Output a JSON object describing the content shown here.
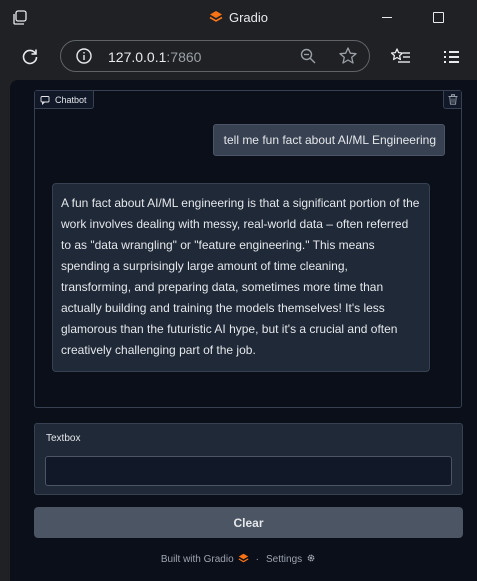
{
  "browser": {
    "tab_title": "Gradio",
    "url_host": "127.0.0.1",
    "url_port": ":7860"
  },
  "chatbot": {
    "label": "Chatbot",
    "messages": [
      {
        "role": "user",
        "text": "tell me fun fact about AI/ML Engineering"
      },
      {
        "role": "bot",
        "text": "A fun fact about AI/ML engineering is that a significant portion of the work involves dealing with messy, real-world data – often referred to as \"data wrangling\" or \"feature engineering.\" This means spending a surprisingly large amount of time cleaning, transforming, and preparing data, sometimes more time than actually building and training the models themselves! It's less glamorous than the futuristic AI hype, but it's a crucial and often creatively challenging part of the job."
      }
    ]
  },
  "textbox": {
    "label": "Textbox",
    "value": "",
    "placeholder": ""
  },
  "clear_button": {
    "label": "Clear"
  },
  "footer": {
    "built_with": "Built with Gradio",
    "separator": "·",
    "settings": "Settings"
  },
  "colors": {
    "page_bg": "#0b0f19",
    "panel_bg": "#1f2937",
    "border": "#374151",
    "gradio_orange": "#f97316"
  },
  "icons": [
    "tab-search-icon",
    "gradio-logo-icon",
    "minimize-icon",
    "maximize-icon",
    "reload-icon",
    "site-info-icon",
    "zoom-icon",
    "bookmark-star-icon",
    "favorites-list-icon",
    "chat-bubble-icon",
    "trash-icon",
    "gear-icon"
  ]
}
